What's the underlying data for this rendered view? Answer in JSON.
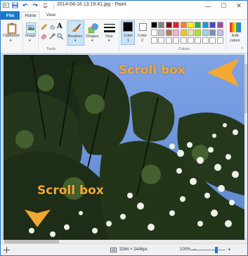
{
  "window": {
    "title": "2014-04-16 13.19.41.jpg - Paint"
  },
  "title_controls": {
    "minimize": "—",
    "maximize": "☐",
    "close": "✕"
  },
  "tabs": [
    {
      "label": "File"
    },
    {
      "label": "Home"
    },
    {
      "label": "View"
    }
  ],
  "ribbon": {
    "clipboard_label": "Clipboard",
    "image_label": "Image",
    "tools_group": "Tools",
    "brushes_label": "Brushes",
    "shapes_label": "Shapes",
    "size_label": "Size",
    "color1_label": "Color",
    "color1_num": "1",
    "color2_label": "Color",
    "color2_num": "2",
    "colors_group": "Colors",
    "edit_colors_label": "Edit",
    "edit_colors_label2": "colors",
    "text_tool_glyph": "A"
  },
  "palette": {
    "row1": [
      "#000000",
      "#7f7f7f",
      "#880015",
      "#ed1c24",
      "#ff7f27",
      "#fff200",
      "#22b14c",
      "#00a2e8",
      "#3f48cc",
      "#a349a4"
    ],
    "row2": [
      "#ffffff",
      "#c3c3c3",
      "#b97a57",
      "#ffaec9",
      "#ffc90e",
      "#efe4b0",
      "#b5e61d",
      "#99d9ea",
      "#7092be",
      "#c8bfe7"
    ],
    "row3": [
      "#ffffff",
      "#ffffff",
      "#ffffff",
      "#ffffff",
      "#ffffff",
      "#ffffff",
      "#ffffff",
      "#ffffff",
      "#ffffff",
      "#ffffff"
    ],
    "color1": "#000000",
    "color2": "#ffffff"
  },
  "annotations": {
    "top_label": "Scroll box",
    "bottom_label": "Scroll box",
    "arrow_color": "#f3a833"
  },
  "status": {
    "dimensions": "3264 × 2448px",
    "zoom": "100%",
    "zoom_minus": "–",
    "zoom_plus": "+"
  }
}
